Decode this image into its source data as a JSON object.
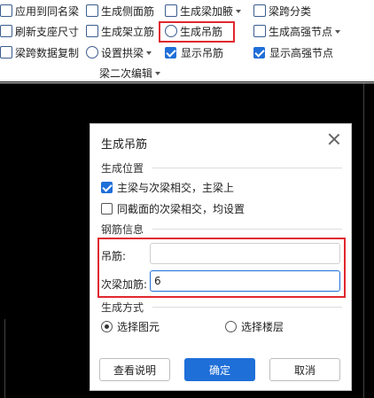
{
  "ribbon": {
    "row1": [
      {
        "label": "应用到同名梁",
        "icon": "apply-same-name-icon"
      },
      {
        "label": "生成侧面筋",
        "icon": "side-rebar-icon"
      },
      {
        "label": "生成梁加腋",
        "icon": "beam-haunch-icon",
        "dropdown": true
      },
      {
        "label": "梁跨分类",
        "icon": "span-classify-icon"
      }
    ],
    "row2": [
      {
        "label": "刷新支座尺寸",
        "icon": "refresh-support-icon"
      },
      {
        "label": "生成架立筋",
        "icon": "erection-rebar-icon"
      },
      {
        "label": "生成吊筋",
        "icon": "hanger-rebar-icon"
      },
      {
        "label": "生成高强节点",
        "icon": "high-strength-node-icon",
        "dropdown": true
      }
    ],
    "row3": [
      {
        "label": "梁跨数据复制",
        "icon": "copy-span-data-icon"
      },
      {
        "label": "设置拱梁",
        "icon": "arch-beam-icon",
        "dropdown": true
      },
      {
        "label": "显示吊筋",
        "checked": true
      },
      {
        "label": "显示高强节点",
        "checked": true
      }
    ],
    "group_label": "梁二次编辑"
  },
  "dialog": {
    "title": "生成吊筋",
    "section_position": "生成位置",
    "option_main_sub": {
      "label": "主梁与次梁相交，主梁上",
      "checked": true
    },
    "option_same_section": {
      "label": "同截面的次梁相交，均设置",
      "checked": false
    },
    "section_rebar": "钢筋信息",
    "hanger_label": "吊筋:",
    "hanger_value": "",
    "sub_beam_label": "次梁加筋:",
    "sub_beam_value": "6",
    "section_method": "生成方式",
    "radio_element": {
      "label": "选择图元",
      "selected": true
    },
    "radio_floor": {
      "label": "选择楼层",
      "selected": false
    },
    "btn_help": "查看说明",
    "btn_ok": "确定",
    "btn_cancel": "取消"
  },
  "colors": {
    "accent": "#1f6fd8",
    "highlight": "#e0282e"
  }
}
